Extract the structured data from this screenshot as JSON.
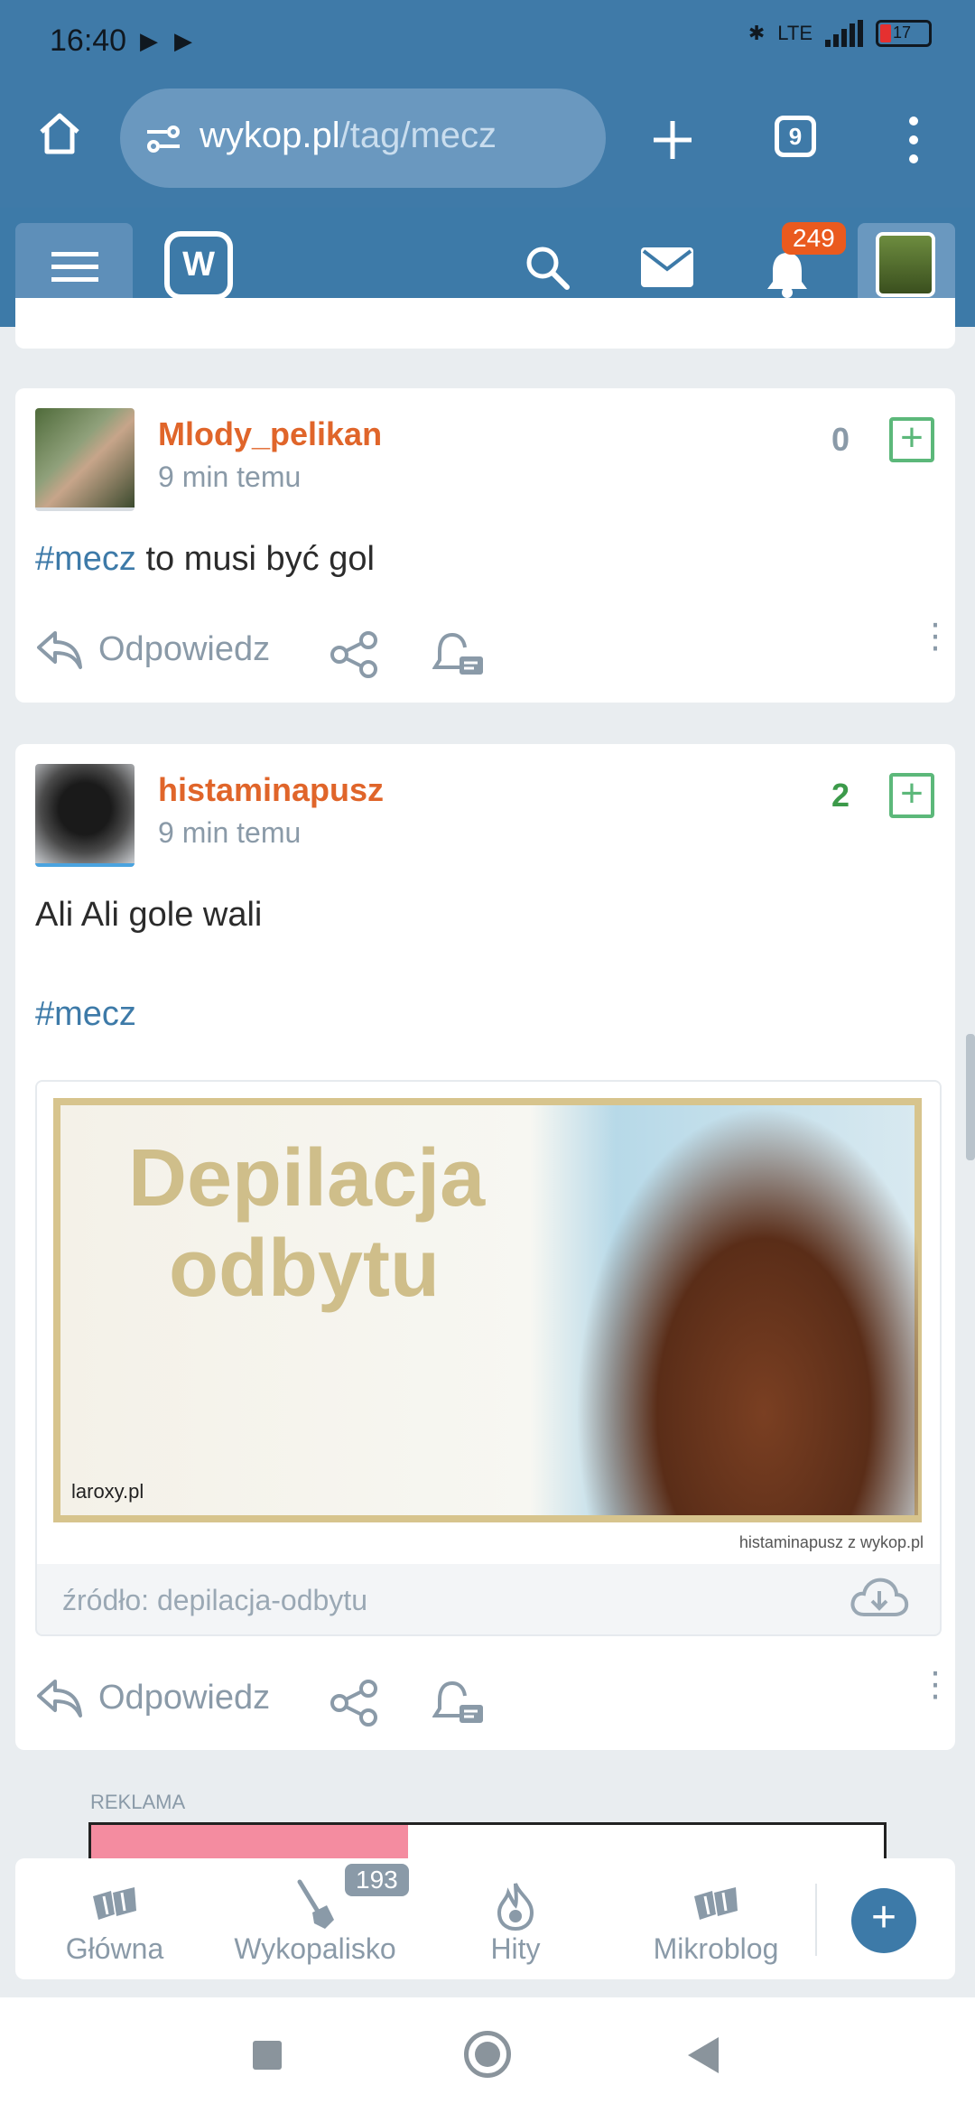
{
  "status_bar": {
    "time": "16:40",
    "battery": "17",
    "network": "LTE"
  },
  "browser": {
    "url_host": "wykop.pl",
    "url_path": "/tag/mecz",
    "tab_count": "9"
  },
  "header": {
    "notification_count": "249"
  },
  "posts": [
    {
      "username": "Mlody_pelikan",
      "time": "9 min temu",
      "score": "0",
      "tag": "#mecz",
      "text": " to musi być gol",
      "reply_label": "Odpowiedz"
    },
    {
      "username": "histaminapusz",
      "time": "9 min temu",
      "score": "2",
      "text": "Ali Ali gole wali",
      "tag": "#mecz",
      "reply_label": "Odpowiedz",
      "embed": {
        "title_line1": "Depilacja",
        "title_line2": "odbytu",
        "brand": "laroxy.pl",
        "credit": "histaminapusz z  wykop.pl",
        "source": "źródło: depilacja-odbytu"
      }
    }
  ],
  "ad": {
    "label": "REKLAMA"
  },
  "bottom_nav": {
    "items": [
      {
        "label": "Główna"
      },
      {
        "label": "Wykopalisko"
      },
      {
        "label": "Hity"
      },
      {
        "label": "Mikroblog"
      }
    ],
    "wykopalisko_badge": "193",
    "fab_label": "+"
  },
  "colors": {
    "accent": "#3d7aa8",
    "username": "#e0652a",
    "upvote": "#5cb87a"
  }
}
